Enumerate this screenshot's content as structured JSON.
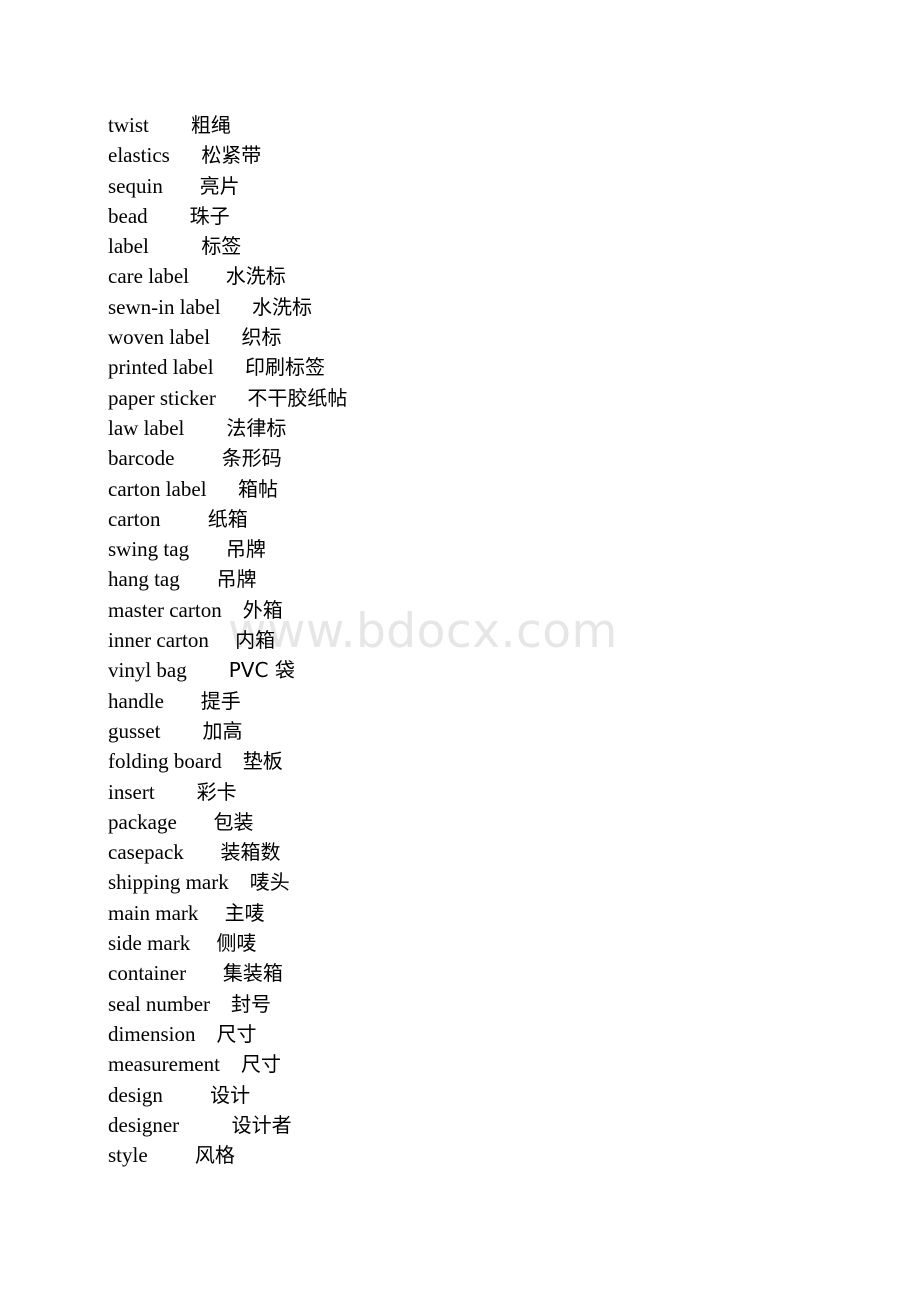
{
  "document": {
    "type": "bilingual-glossary",
    "language_pair": "English-Chinese",
    "background_color": "#ffffff",
    "text_color": "#000000"
  },
  "watermark": {
    "text": "www.bdocx.com",
    "color": "#e6e6e6"
  },
  "glossary": {
    "entries": [
      {
        "term": "twist",
        "gap": "        ",
        "gloss": "粗绳"
      },
      {
        "term": "elastics",
        "gap": "      ",
        "gloss": "松紧带"
      },
      {
        "term": "sequin",
        "gap": "       ",
        "gloss": "亮片"
      },
      {
        "term": "bead",
        "gap": "        ",
        "gloss": "珠子"
      },
      {
        "term": "label",
        "gap": "          ",
        "gloss": "标签"
      },
      {
        "term": "care label",
        "gap": "       ",
        "gloss": "水洗标"
      },
      {
        "term": "sewn-in label",
        "gap": "      ",
        "gloss": "水洗标"
      },
      {
        "term": "woven label",
        "gap": "      ",
        "gloss": "织标"
      },
      {
        "term": "printed label",
        "gap": "      ",
        "gloss": "印刷标签"
      },
      {
        "term": "paper sticker",
        "gap": "      ",
        "gloss": "不干胶纸帖"
      },
      {
        "term": "law label",
        "gap": "        ",
        "gloss": "法律标"
      },
      {
        "term": "barcode",
        "gap": "         ",
        "gloss": "条形码"
      },
      {
        "term": "carton label",
        "gap": "      ",
        "gloss": "箱帖"
      },
      {
        "term": "carton",
        "gap": "         ",
        "gloss": "纸箱"
      },
      {
        "term": "swing tag",
        "gap": "       ",
        "gloss": "吊牌"
      },
      {
        "term": "hang tag",
        "gap": "       ",
        "gloss": "吊牌"
      },
      {
        "term": "master carton",
        "gap": "    ",
        "gloss": "外箱"
      },
      {
        "term": "inner carton",
        "gap": "     ",
        "gloss": "内箱"
      },
      {
        "term": "vinyl bag",
        "gap": "        ",
        "gloss": "PVC 袋"
      },
      {
        "term": "handle",
        "gap": "       ",
        "gloss": "提手"
      },
      {
        "term": "gusset",
        "gap": "        ",
        "gloss": "加高"
      },
      {
        "term": "folding board",
        "gap": "    ",
        "gloss": "垫板"
      },
      {
        "term": "insert",
        "gap": "        ",
        "gloss": "彩卡"
      },
      {
        "term": "package",
        "gap": "       ",
        "gloss": "包装"
      },
      {
        "term": "casepack",
        "gap": "       ",
        "gloss": "装箱数"
      },
      {
        "term": "shipping mark",
        "gap": "    ",
        "gloss": "唛头"
      },
      {
        "term": "main mark",
        "gap": "     ",
        "gloss": "主唛"
      },
      {
        "term": "side mark",
        "gap": "     ",
        "gloss": "侧唛"
      },
      {
        "term": "container",
        "gap": "       ",
        "gloss": "集装箱"
      },
      {
        "term": "seal number",
        "gap": "    ",
        "gloss": "封号"
      },
      {
        "term": "dimension",
        "gap": "    ",
        "gloss": "尺寸"
      },
      {
        "term": "measurement",
        "gap": "    ",
        "gloss": "尺寸"
      },
      {
        "term": "design",
        "gap": "         ",
        "gloss": "设计"
      },
      {
        "term": "designer",
        "gap": "          ",
        "gloss": "设计者"
      },
      {
        "term": "style",
        "gap": "         ",
        "gloss": "风格"
      }
    ]
  }
}
